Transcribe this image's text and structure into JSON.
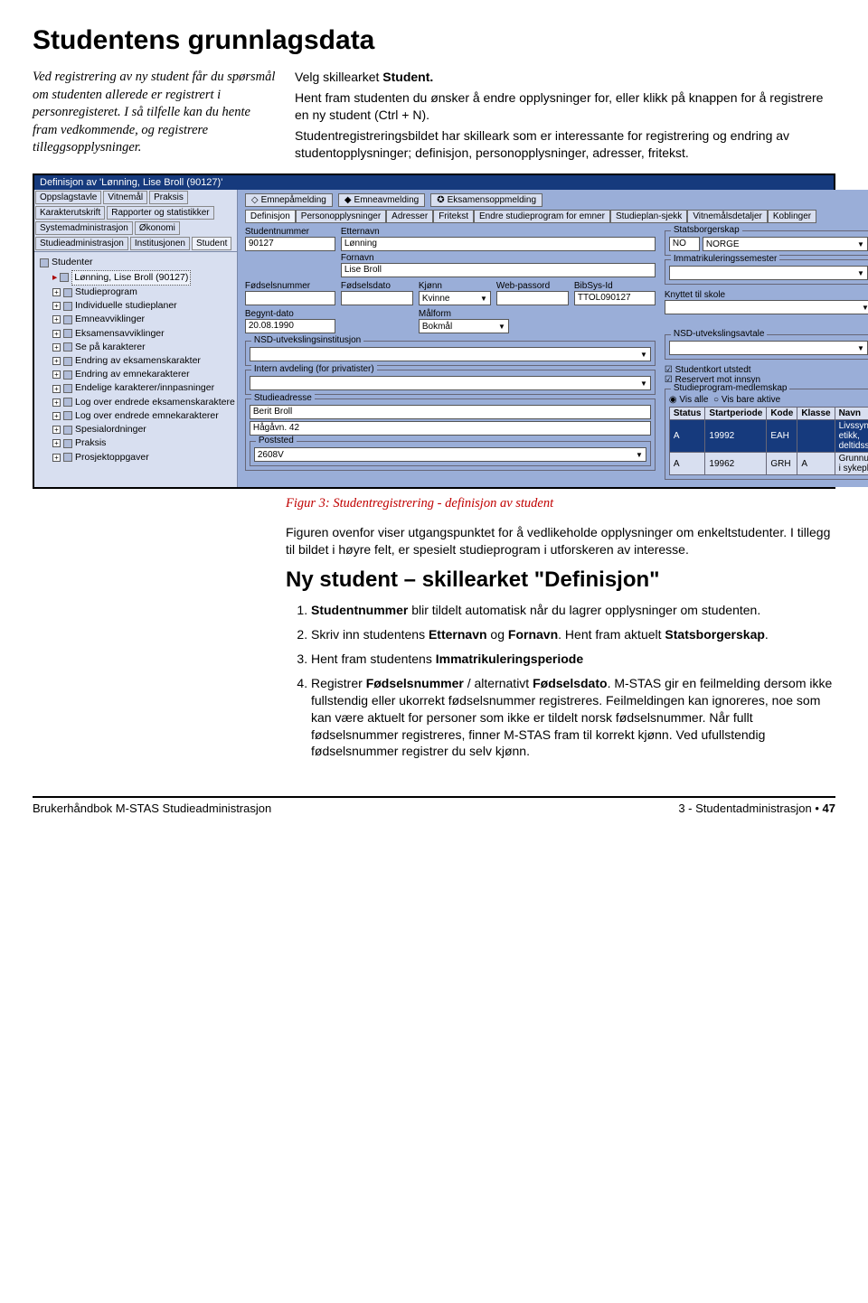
{
  "heading": "Studentens grunnlagsdata",
  "left_para": "Ved registrering av ny student får du spørsmål om studenten allerede er registrert i personregisteret. I så tilfelle kan du hente fram vedkommende, og registrere tilleggsopplysninger.",
  "right_p1_a": "Velg skillearket ",
  "right_p1_b": "Student.",
  "right_p2": "Hent fram studenten du ønsker å endre opplysninger for, eller klikk på knappen for å registrere en ny student (Ctrl + N).",
  "right_p3": "Studentregistreringsbildet har skilleark som er interessante for registrering og endring av studentopplysninger; definisjon, personopplysninger, adresser, fritekst.",
  "screenshot": {
    "title": "Definisjon av 'Lønning, Lise Broll (90127)'",
    "left_tabs": [
      "Oppslagstavle",
      "Vitnemål",
      "Praksis",
      "Karakterutskrift",
      "Rapporter og statistikker",
      "Systemadministrasjon",
      "Økonomi",
      "Studieadministrasjon",
      "Institusjonen",
      "Student"
    ],
    "left_tabs_active": "Student",
    "tree_root": "Studenter",
    "tree_selected": "Lønning, Lise Broll (90127)",
    "tree_items": [
      "Studieprogram",
      "Individuelle studieplaner",
      "Emneavviklinger",
      "Eksamensavviklinger",
      "Se på karakterer",
      "Endring av eksamenskarakter",
      "Endring av emnekarakterer",
      "Endelige karakterer/innpasninger",
      "Log over endrede eksamenskaraktere",
      "Log over endrede emnekarakterer",
      "Spesialordninger",
      "Praksis",
      "Prosjektoppgaver"
    ],
    "toolbar": [
      {
        "icon": "◇",
        "label": "Emnepåmelding"
      },
      {
        "icon": "◆",
        "label": "Emneavmelding"
      },
      {
        "icon": "✪",
        "label": "Eksamensoppmelding"
      }
    ],
    "subtabs": [
      "Definisjon",
      "Personopplysninger",
      "Adresser",
      "Fritekst",
      "Endre studieprogram for emner",
      "Studieplan-sjekk",
      "Vitnemålsdetaljer",
      "Koblinger"
    ],
    "subtab_active": "Definisjon",
    "labels": {
      "studentnummer": "Studentnummer",
      "etternavn": "Etternavn",
      "fornavn": "Fornavn",
      "statsborgerskap": "Statsborgerskap",
      "immatrik": "Immatrikuleringssemester",
      "fodselsnummer": "Fødselsnummer",
      "fodselsdato": "Fødselsdato",
      "kjonn": "Kjønn",
      "webpassord": "Web-passord",
      "bibsys": "BibSys-Id",
      "knyttet": "Knyttet til skole",
      "begynt": "Begynt-dato",
      "malform": "Målform",
      "nsd_inst": "NSD-utvekslingsinstitusjon",
      "nsd_avtale": "NSD-utvekslingsavtale",
      "intern": "Intern avdeling (for privatister)",
      "studentkort": "Studentkort utstedt",
      "reservert": "Reservert mot innsyn",
      "studieadresse": "Studieadresse",
      "poststed": "Poststed",
      "medlemskap": "Studieprogram-medlemskap",
      "visalle": "Vis alle",
      "visaktive": "Vis bare aktive"
    },
    "values": {
      "studentnummer": "90127",
      "etternavn": "Lønning",
      "fornavn": "Lise Broll",
      "stats_code": "NO",
      "stats_name": "NORGE",
      "kjonn": "Kvinne",
      "bibsys": "TTOL090127",
      "begynt": "20.08.1990",
      "malform": "Bokmål",
      "adr1": "Berit Broll",
      "adr2": "Hågåvn. 42",
      "poststed": "2608V"
    },
    "table_head": [
      "Status",
      "Startperiode",
      "Kode",
      "Klasse",
      "Navn"
    ],
    "table_rows": [
      {
        "sel": true,
        "cells": [
          "A",
          "19992",
          "EAH",
          "",
          "Livssyn og etikk, deltidsstudium"
        ]
      },
      {
        "sel": false,
        "cells": [
          "A",
          "19962",
          "GRH",
          "A",
          "Grunnutdanning i sykepleie - hel"
        ]
      }
    ]
  },
  "caption": "Figur 3: Studentregistrering - definisjon av student",
  "below_para": "Figuren ovenfor viser utgangspunktet for å vedlikeholde opplysninger om enkeltstudenter. I tillegg til bildet i høyre felt, er spesielt studieprogram i utforskeren av interesse.",
  "h2": "Ny student – skillearket \"Definisjon\"",
  "list": {
    "i1_a": "Studentnummer",
    "i1_b": " blir tildelt automatisk når du lagrer opplysninger om studenten.",
    "i2_a": "Skriv inn studentens ",
    "i2_b": "Etternavn",
    "i2_c": " og ",
    "i2_d": "Fornavn",
    "i2_e": ". Hent fram aktuelt ",
    "i2_f": "Statsborgerskap",
    "i2_g": ".",
    "i3_a": "Hent fram studentens ",
    "i3_b": "Immatrikuleringsperiode",
    "i4_a": "Registrer ",
    "i4_b": "Fødselsnummer",
    "i4_c": " / alternativt ",
    "i4_d": "Fødselsdato",
    "i4_e": ". M-STAS gir en feilmelding dersom ikke fullstendig eller ukorrekt fødselsnummer registreres. Feilmeldingen kan ignoreres, noe som kan være aktuelt for personer som ikke er tildelt norsk fødselsnummer. Når fullt fødselsnummer registreres, finner M-STAS fram til korrekt kjønn. Ved ufullstendig fødselsnummer registrer du selv kjønn."
  },
  "footer": {
    "left": "Brukerhåndbok M-STAS Studieadministrasjon",
    "right_a": "3 - Studentadministrasjon ",
    "right_b": "47"
  }
}
